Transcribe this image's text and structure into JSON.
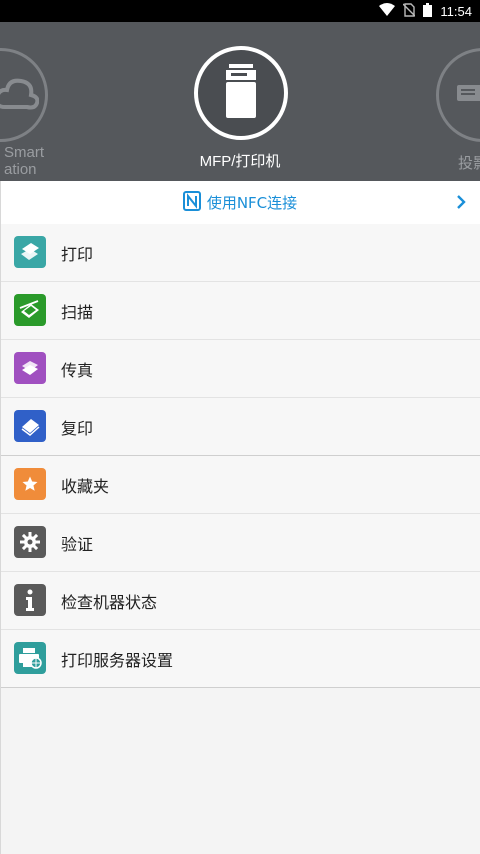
{
  "status_bar": {
    "time": "11:54"
  },
  "devices": {
    "left_label_line1": "Smart",
    "left_label_line2": "ation",
    "center_label": "MFP/打印机",
    "right_label": "投影"
  },
  "nfc": {
    "label": "使用NFC连接"
  },
  "menu": {
    "items": [
      {
        "label": "打印",
        "color": "#3aa7a6"
      },
      {
        "label": "扫描",
        "color": "#2a9a2a"
      },
      {
        "label": "传真",
        "color": "#a050c0"
      },
      {
        "label": "复印",
        "color": "#3060c8"
      },
      {
        "label": "收藏夹",
        "color": "#f08c3a"
      },
      {
        "label": "验证",
        "color": "#5a5a5a"
      },
      {
        "label": "检查机器状态",
        "color": "#5a5a5a"
      },
      {
        "label": "打印服务器设置",
        "color": "#2f9e9c"
      }
    ]
  }
}
